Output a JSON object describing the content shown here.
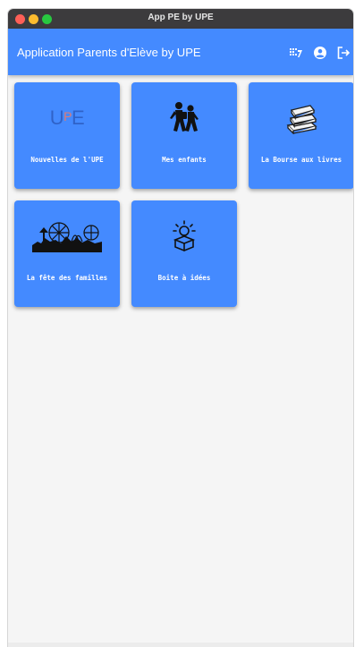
{
  "window": {
    "title": "App PE by UPE"
  },
  "appbar": {
    "title": "Application Parents d'Elève by UPE",
    "actions": [
      {
        "icon": "theme-palette-icon"
      },
      {
        "icon": "account-circle-icon"
      },
      {
        "icon": "logout-icon"
      }
    ]
  },
  "upe_logo": {
    "letters": [
      "U",
      "P",
      "E"
    ]
  },
  "tiles": [
    {
      "label": "Nouvelles de l'UPE",
      "icon": "upe-logo"
    },
    {
      "label": "Mes enfants",
      "icon": "children-walking-icon"
    },
    {
      "label": "La Bourse aux livres",
      "icon": "books-stack-icon"
    },
    {
      "label": "La fête des familles",
      "icon": "fair-skyline-icon"
    },
    {
      "label": "Boite à idées",
      "icon": "idea-lightbulb-box-icon"
    }
  ],
  "colors": {
    "primary": "#448aff",
    "titlebar": "#3c3b3d",
    "background": "#f5f5f5",
    "on_primary": "#ffffff"
  }
}
